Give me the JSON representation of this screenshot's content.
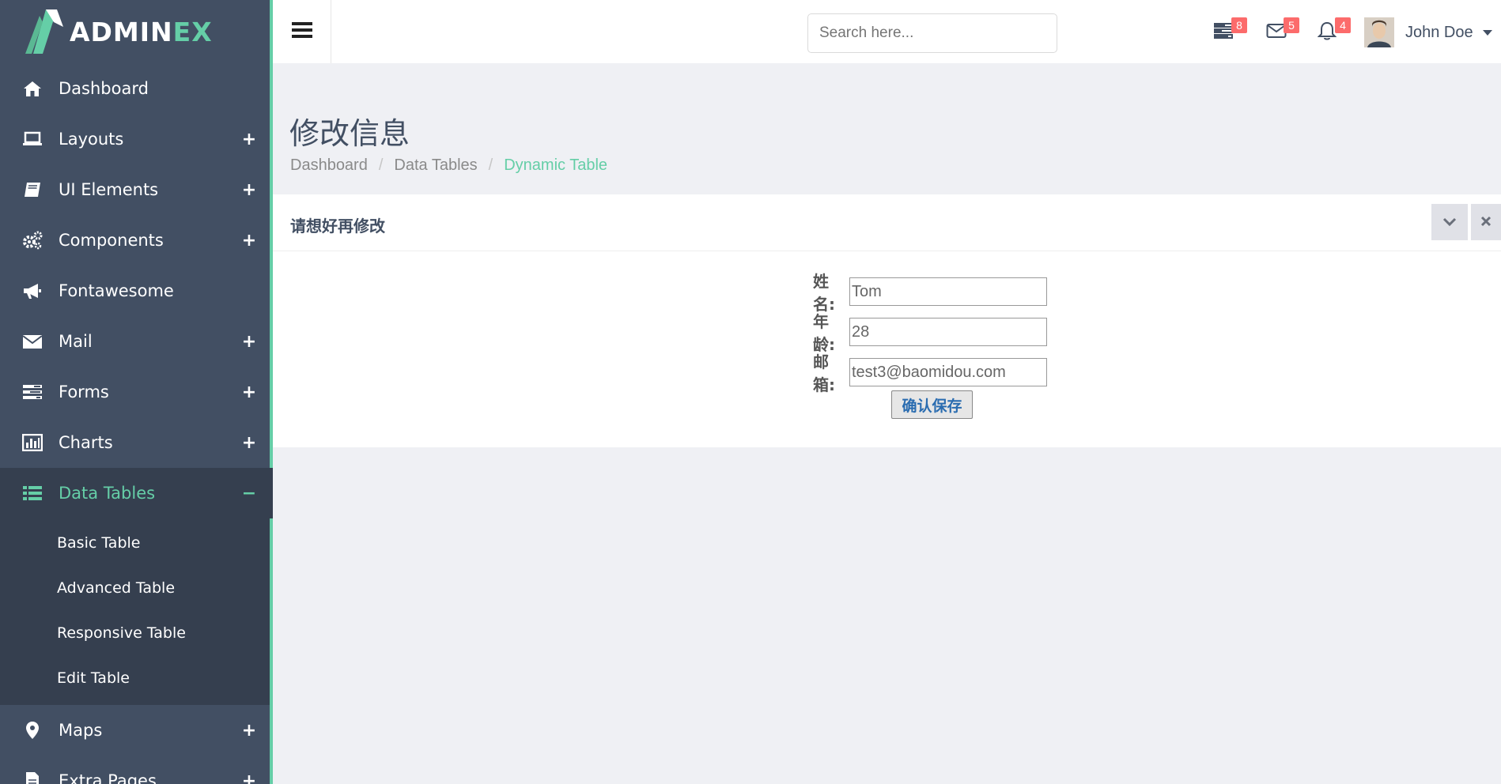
{
  "brand": {
    "prefix": "ADMIN",
    "suffix": "EX",
    "accent_color": "#65cea7",
    "sidebar_color": "#424f63"
  },
  "sidebar": {
    "items": [
      {
        "label": "Dashboard",
        "icon": "home-icon",
        "toggle": ""
      },
      {
        "label": "Layouts",
        "icon": "laptop-icon",
        "toggle": "+"
      },
      {
        "label": "UI Elements",
        "icon": "book-icon",
        "toggle": "+"
      },
      {
        "label": "Components",
        "icon": "cogs-icon",
        "toggle": "+"
      },
      {
        "label": "Fontawesome",
        "icon": "bullhorn-icon",
        "toggle": ""
      },
      {
        "label": "Mail",
        "icon": "envelope-icon",
        "toggle": "+"
      },
      {
        "label": "Forms",
        "icon": "tasks-icon",
        "toggle": "+"
      },
      {
        "label": "Charts",
        "icon": "bar-chart-icon",
        "toggle": "+"
      },
      {
        "label": "Data Tables",
        "icon": "table-icon",
        "toggle": "−"
      },
      {
        "label": "Maps",
        "icon": "map-marker-icon",
        "toggle": "+"
      },
      {
        "label": "Extra Pages",
        "icon": "file-icon",
        "toggle": "+"
      }
    ],
    "submenu": [
      "Basic Table",
      "Advanced Table",
      "Responsive Table",
      "Edit Table"
    ]
  },
  "header": {
    "search_placeholder": "Search here...",
    "badges": {
      "tasks": "8",
      "mail": "5",
      "notifications": "4"
    },
    "user_name": "John Doe"
  },
  "page": {
    "title": "修改信息",
    "breadcrumb": [
      "Dashboard",
      "Data Tables",
      "Dynamic Table"
    ]
  },
  "panel": {
    "title": "请想好再修改",
    "form": {
      "name_label": "姓名:",
      "name_value": "Tom",
      "age_label": "年龄:",
      "age_value": "28",
      "email_label": "邮箱:",
      "email_value": "test3@baomidou.com",
      "save_label": "确认保存"
    }
  }
}
